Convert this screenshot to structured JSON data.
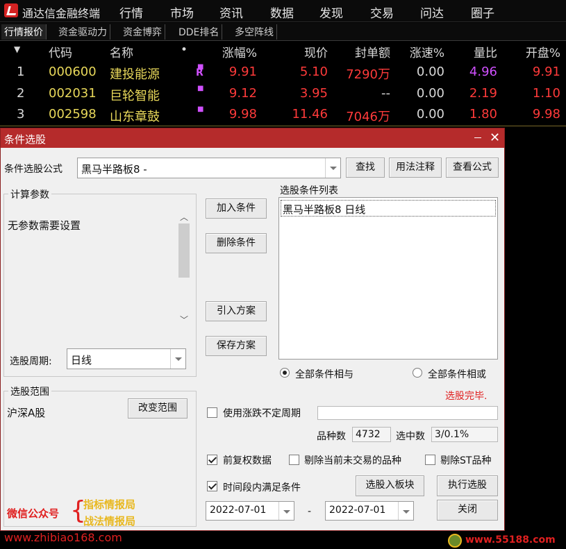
{
  "app": {
    "title": "通达信金融终端"
  },
  "menu": [
    "行情",
    "市场",
    "资讯",
    "数据",
    "发现",
    "交易",
    "问达",
    "圈子"
  ],
  "tabs": [
    "行情报价",
    "资金驱动力",
    "资金博弈",
    "DDE排名",
    "多空阵线"
  ],
  "quote_table": {
    "headers": {
      "code": "代码",
      "name": "名称",
      "dot": "•",
      "change_pct": "涨幅%",
      "price": "现价",
      "seal": "封单额",
      "speed": "涨速%",
      "vol_ratio": "量比",
      "open_pct": "开盘%"
    },
    "rows": [
      {
        "no": "1",
        "code": "000600",
        "name": "建投能源",
        "flag": "R",
        "change_pct": "9.91",
        "price": "5.10",
        "seal": "7290万",
        "speed": "0.00",
        "vol_ratio": "4.96",
        "open_pct": "9.91"
      },
      {
        "no": "2",
        "code": "002031",
        "name": "巨轮智能",
        "flag": "",
        "change_pct": "9.12",
        "price": "3.95",
        "seal": "--",
        "speed": "0.00",
        "vol_ratio": "2.19",
        "open_pct": "1.10"
      },
      {
        "no": "3",
        "code": "002598",
        "name": "山东章鼓",
        "flag": "",
        "change_pct": "9.98",
        "price": "11.46",
        "seal": "7046万",
        "speed": "0.00",
        "vol_ratio": "1.80",
        "open_pct": "9.98"
      }
    ]
  },
  "dialog": {
    "title": "条件选股",
    "formula_label": "条件选股公式",
    "formula_value": "黑马半路板8  -",
    "find_btn": "查找",
    "usage_btn": "用法注释",
    "view_formula_btn": "查看公式",
    "params_group": "计算参数",
    "params_text": "无参数需要设置",
    "period_label": "选股周期:",
    "period_value": "日线",
    "add_cond_btn": "加入条件",
    "del_cond_btn": "删除条件",
    "import_plan_btn": "引入方案",
    "save_plan_btn": "保存方案",
    "cond_list_label": "选股条件列表",
    "cond_items": [
      "黑马半路板8 日线"
    ],
    "radio_and": "全部条件相与",
    "radio_or": "全部条件相或",
    "status": "选股完毕.",
    "range_group": "选股范围",
    "range_value": "沪深A股",
    "change_range_btn": "改变范围",
    "use_period_label": "使用涨跌不定周期",
    "count_label": "品种数",
    "count_value": "4732",
    "selected_label": "选中数",
    "selected_value": "3/0.1%",
    "fq_label": "前复权数据",
    "exclude_untraded_label": "剔除当前未交易的品种",
    "exclude_st_label": "剔除ST品种",
    "time_cond_label": "时间段内满足条件",
    "to_block_btn": "选股入板块",
    "execute_btn": "执行选股",
    "date_from": "2022-07-01",
    "date_sep": "-",
    "date_to": "2022-07-01",
    "close_btn": "关闭"
  },
  "watermark": {
    "wechat": "微信公众号",
    "brace": "{",
    "name1": "指标情报局",
    "name2": "战法情报局",
    "url_left": "www.zhibiao168.com",
    "url_right": "www.55188.com"
  },
  "colors": {
    "red": "#ff3a3a",
    "yellow": "#e8d85a",
    "magenta": "#d050ff",
    "title_red": "#b52b2b"
  }
}
